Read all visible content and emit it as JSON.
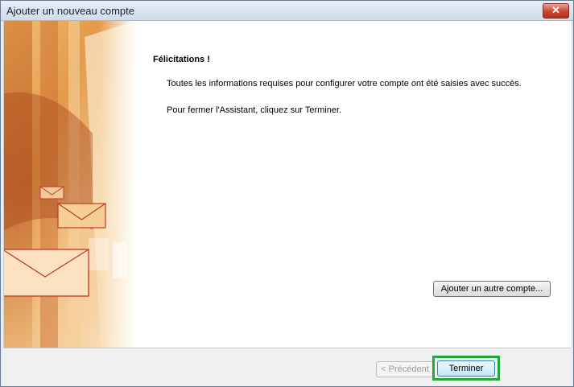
{
  "window": {
    "title": "Ajouter un nouveau compte",
    "close_label": "✕"
  },
  "content": {
    "heading": "Félicitations !",
    "message_info": "Toutes les informations requises pour configurer votre compte ont été saisies avec succès.",
    "message_close": "Pour fermer l'Assistant, cliquez sur Terminer.",
    "add_account_label": "Ajouter un autre compte..."
  },
  "footer": {
    "previous_label": "< Précédent",
    "finish_label": "Terminer"
  },
  "colors": {
    "highlight": "#22a83a",
    "art_orange": "#e8a04a",
    "envelope_red": "#c0392b"
  },
  "icons": [
    "close-icon",
    "envelope-icon"
  ]
}
